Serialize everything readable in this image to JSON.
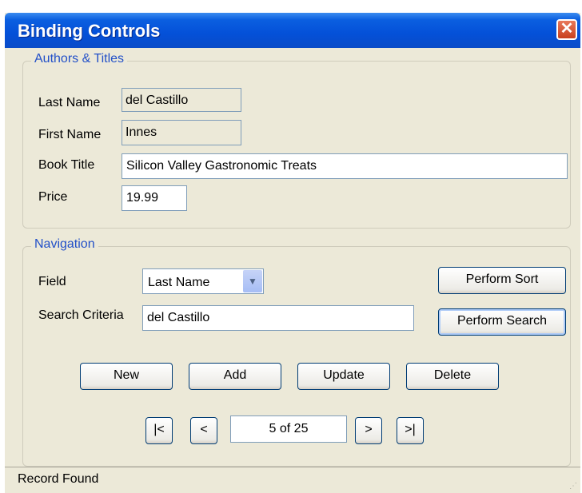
{
  "window": {
    "title": "Binding Controls",
    "close_label": "✕"
  },
  "authors_titles": {
    "legend": "Authors & Titles",
    "last_name_label": "Last Name",
    "last_name_value": "del Castillo",
    "first_name_label": "First Name",
    "first_name_value": "Innes",
    "book_title_label": "Book Title",
    "book_title_value": "Silicon Valley Gastronomic Treats",
    "price_label": "Price",
    "price_value": "19.99"
  },
  "navigation": {
    "legend": "Navigation",
    "field_label": "Field",
    "field_selected": "Last Name",
    "search_criteria_label": "Search Criteria",
    "search_criteria_value": "del Castillo",
    "perform_sort_label": "Perform Sort",
    "perform_search_label": "Perform Search",
    "new_label": "New",
    "add_label": "Add",
    "update_label": "Update",
    "delete_label": "Delete",
    "first_label": "|<",
    "prev_label": "<",
    "position_text": "5 of 25",
    "next_label": ">",
    "last_label": ">|"
  },
  "status": {
    "text": "Record Found"
  }
}
